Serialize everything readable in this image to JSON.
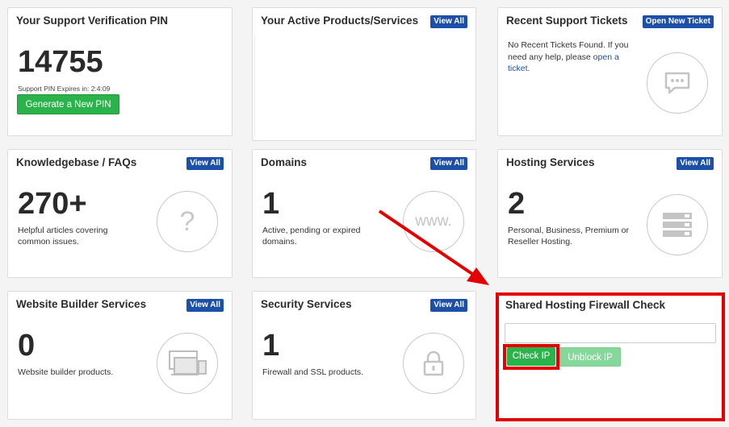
{
  "pin_card": {
    "title": "Your Support Verification PIN",
    "pin": "14755",
    "expires": "Support PIN Expires in: 2:4:09",
    "button": "Generate a New PIN"
  },
  "products_card": {
    "title": "Your Active Products/Services",
    "view_all": "View All"
  },
  "tickets_card": {
    "title": "Recent Support Tickets",
    "button": "Open New Ticket",
    "text_before": "No Recent Tickets Found. If you need any help, please",
    "link": "open a ticket",
    "text_after": ".",
    "icon": "chat-icon"
  },
  "kb_card": {
    "title": "Knowledgebase / FAQs",
    "view_all": "View All",
    "count": "270+",
    "desc": "Helpful articles covering common issues.",
    "icon": "question-icon",
    "icon_text": "?"
  },
  "domains_card": {
    "title": "Domains",
    "view_all": "View All",
    "count": "1",
    "desc": "Active, pending or expired domains.",
    "icon": "www-icon",
    "icon_text": "www."
  },
  "hosting_card": {
    "title": "Hosting Services",
    "view_all": "View All",
    "count": "2",
    "desc": "Personal, Business, Premium or Reseller Hosting.",
    "icon": "server-icon"
  },
  "builder_card": {
    "title": "Website Builder Services",
    "view_all": "View All",
    "count": "0",
    "desc": "Website builder products.",
    "icon": "devices-icon"
  },
  "security_card": {
    "title": "Security Services",
    "view_all": "View All",
    "count": "1",
    "desc": "Firewall and SSL products.",
    "icon": "lock-icon"
  },
  "firewall_card": {
    "title": "Shared Hosting Firewall Check",
    "input_value": "",
    "input_placeholder": "",
    "check_button": "Check IP",
    "unblock_button": "Unblock IP"
  },
  "colors": {
    "accent_blue": "#1c4fa8",
    "green": "#2bb34b",
    "green_light": "#86d79a",
    "highlight_red": "#e30000"
  }
}
